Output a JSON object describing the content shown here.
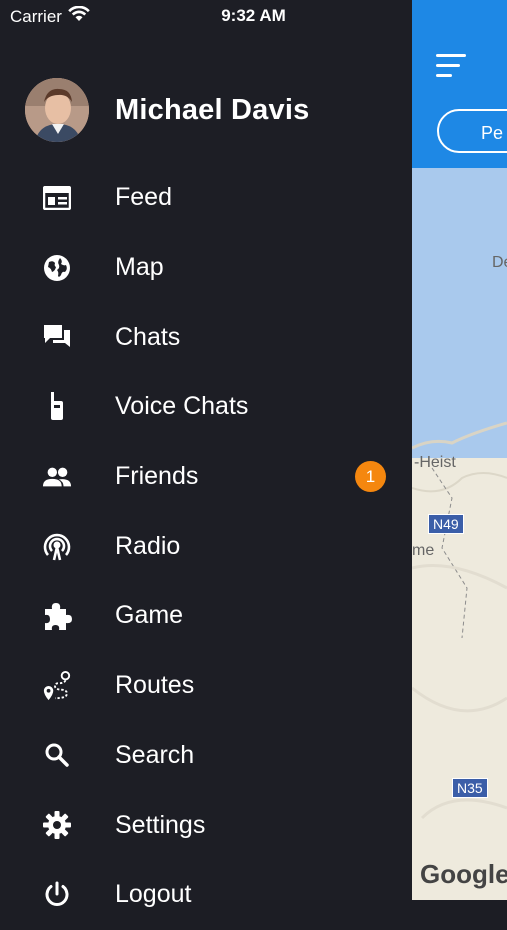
{
  "status": {
    "carrier": "Carrier",
    "time": "9:32 AM"
  },
  "profile": {
    "name": "Michael Davis"
  },
  "menu": [
    {
      "label": "Feed",
      "icon": "feed-icon"
    },
    {
      "label": "Map",
      "icon": "globe-icon"
    },
    {
      "label": "Chats",
      "icon": "chats-icon"
    },
    {
      "label": "Voice Chats",
      "icon": "walkie-talkie-icon"
    },
    {
      "label": "Friends",
      "icon": "friends-icon",
      "badge": "1"
    },
    {
      "label": "Radio",
      "icon": "radio-icon"
    },
    {
      "label": "Game",
      "icon": "puzzle-icon"
    },
    {
      "label": "Routes",
      "icon": "routes-icon"
    },
    {
      "label": "Search",
      "icon": "search-icon"
    },
    {
      "label": "Settings",
      "icon": "gear-icon"
    },
    {
      "label": "Logout",
      "icon": "power-icon"
    }
  ],
  "map": {
    "pill_label": "Pe",
    "labels": [
      "De",
      "-Heist",
      "me"
    ],
    "roads": [
      "N49",
      "N35"
    ],
    "attribution": "Google"
  },
  "colors": {
    "drawer": "#1d1e25",
    "header": "#1e88e5",
    "badge": "#f5870f",
    "battery": "#4cd964"
  }
}
